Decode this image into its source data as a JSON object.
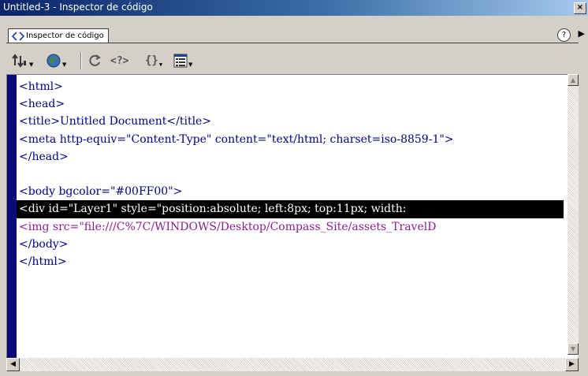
{
  "window": {
    "title": "Untitled-3 - Inspector de código",
    "close_glyph": "×"
  },
  "panel": {
    "tab_label": "Inspector de código",
    "help_glyph": "?",
    "menu_glyph": "▶"
  },
  "toolbar": {
    "buttons": [
      {
        "name": "file-management-icon",
        "has_dropdown": true
      },
      {
        "name": "preview-globe-icon",
        "has_dropdown": true
      },
      {
        "name": "refresh-icon",
        "has_dropdown": false
      },
      {
        "name": "code-navigation-icon",
        "has_dropdown": false
      },
      {
        "name": "braces-icon",
        "has_dropdown": true
      },
      {
        "name": "view-options-icon",
        "has_dropdown": true
      }
    ],
    "dropdown_glyph": "▼",
    "code_nav_text": "<?>",
    "braces_text": "{}"
  },
  "code": {
    "lines": [
      "<html>",
      "<head>",
      "<title>Untitled Document</title>",
      "<meta http-equiv=\"Content-Type\" content=\"text/html; charset=iso-8859-1\">",
      "</head>",
      "",
      "<body bgcolor=\"#00FF00\">",
      "<div id=\"Layer1\" style=\"position:absolute; left:8px; top:11px; width:",
      "<img src=\"file:///C%7C/WINDOWS/Desktop/Compass_Site/assets_TravelD",
      "</body>",
      "</html>"
    ],
    "highlighted_line": 8,
    "img_line": 9
  },
  "colors": {
    "tag_text": "#000080",
    "attribute_img": "#8c1e8c",
    "gutter": "#0a0a7a",
    "selection_bg": "#000000"
  },
  "scrollbars": {
    "up_glyph": "▲",
    "down_glyph": "▼",
    "left_glyph": "◀",
    "right_glyph": "▶"
  }
}
